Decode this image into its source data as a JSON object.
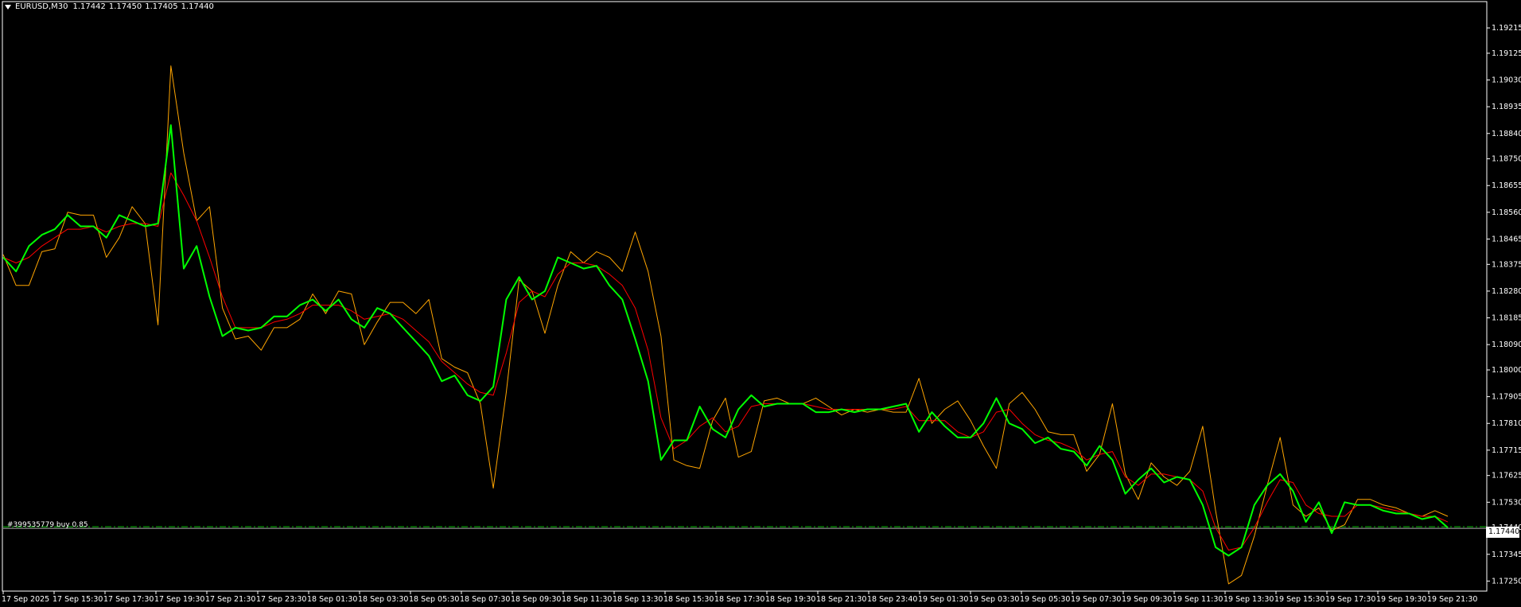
{
  "header": {
    "symbol": "EURUSD,M30",
    "open": "1.17442",
    "high": "1.17450",
    "low": "1.17405",
    "close": "1.17440"
  },
  "price_axis": {
    "labels": [
      "1.19215",
      "1.19125",
      "1.19030",
      "1.18935",
      "1.18840",
      "1.18750",
      "1.18655",
      "1.18560",
      "1.18465",
      "1.18375",
      "1.18280",
      "1.18185",
      "1.18090",
      "1.18000",
      "1.17905",
      "1.17810",
      "1.17715",
      "1.17625",
      "1.17530",
      "1.17440",
      "1.17345",
      "1.17250"
    ],
    "current_price": "1.17440"
  },
  "time_axis": {
    "labels": [
      "17 Sep 2025",
      "17 Sep 15:30",
      "17 Sep 17:30",
      "17 Sep 19:30",
      "17 Sep 21:30",
      "17 Sep 23:30",
      "18 Sep 01:30",
      "18 Sep 03:30",
      "18 Sep 05:30",
      "18 Sep 07:30",
      "18 Sep 09:30",
      "18 Sep 11:30",
      "18 Sep 13:30",
      "18 Sep 15:30",
      "18 Sep 17:30",
      "18 Sep 19:30",
      "18 Sep 21:30",
      "18 Sep 23:40",
      "19 Sep 01:30",
      "19 Sep 03:30",
      "19 Sep 05:30",
      "19 Sep 07:30",
      "19 Sep 09:30",
      "19 Sep 11:30",
      "19 Sep 13:30",
      "19 Sep 15:30",
      "19 Sep 17:30",
      "19 Sep 19:30",
      "19 Sep 21:30"
    ]
  },
  "order": {
    "label": "#399535779 buy 0.85",
    "price": 1.1744
  },
  "colors": {
    "background": "#000000",
    "price_line": "#00ff00",
    "fast_ma": "#ff0000",
    "envelope_line": "#ffa500",
    "order_line": "#00c000",
    "text": "#ffffff"
  },
  "chart_data": {
    "type": "line",
    "title": "EURUSD,M30",
    "xlabel": "",
    "ylabel": "",
    "ylim": [
      1.1722,
      1.193
    ],
    "grid": false,
    "series": [
      {
        "name": "",
        "color": "#00ff00",
        "values": [
          1.184,
          1.1835,
          1.1844,
          1.1848,
          1.185,
          1.1855,
          1.1851,
          1.1851,
          1.1847,
          1.1855,
          1.1853,
          1.1851,
          1.1852,
          1.1887,
          1.1836,
          1.1844,
          1.1826,
          1.1812,
          1.1815,
          1.1814,
          1.1815,
          1.1819,
          1.1819,
          1.1823,
          1.1825,
          1.1821,
          1.1825,
          1.1818,
          1.1815,
          1.1822,
          1.182,
          1.1815,
          1.181,
          1.1805,
          1.1796,
          1.1798,
          1.1791,
          1.1789,
          1.1794,
          1.1825,
          1.1833,
          1.1825,
          1.1828,
          1.184,
          1.1838,
          1.1836,
          1.1837,
          1.183,
          1.1825,
          1.1811,
          1.1796,
          1.1768,
          1.1775,
          1.1775,
          1.1787,
          1.1779,
          1.1776,
          1.1786,
          1.1791,
          1.1787,
          1.1788,
          1.1788,
          1.1788,
          1.1785,
          1.1785,
          1.1786,
          1.1785,
          1.1786,
          1.1786,
          1.1787,
          1.1788,
          1.1778,
          1.1785,
          1.178,
          1.1776,
          1.1776,
          1.1781,
          1.179,
          1.1781,
          1.1779,
          1.1774,
          1.1776,
          1.1772,
          1.1771,
          1.1766,
          1.1773,
          1.1768,
          1.1756,
          1.1761,
          1.1765,
          1.176,
          1.1762,
          1.1761,
          1.1752,
          1.1737,
          1.1734,
          1.1737,
          1.1752,
          1.1759,
          1.1763,
          1.1757,
          1.1746,
          1.1753,
          1.1742,
          1.1753,
          1.1752,
          1.1752,
          1.175,
          1.1749,
          1.1749,
          1.1747,
          1.1748,
          1.1744
        ]
      },
      {
        "name": "",
        "color": "#ff0000",
        "values": [
          1.184,
          1.1838,
          1.184,
          1.1844,
          1.1847,
          1.185,
          1.185,
          1.1851,
          1.1849,
          1.1851,
          1.1852,
          1.1852,
          1.1851,
          1.187,
          1.1862,
          1.1853,
          1.184,
          1.1826,
          1.1815,
          1.1815,
          1.1815,
          1.1817,
          1.1818,
          1.182,
          1.1823,
          1.1823,
          1.1823,
          1.1821,
          1.1818,
          1.1819,
          1.182,
          1.1818,
          1.1814,
          1.181,
          1.1803,
          1.1799,
          1.1795,
          1.1792,
          1.1791,
          1.1806,
          1.1824,
          1.1828,
          1.1826,
          1.1834,
          1.1838,
          1.1838,
          1.1837,
          1.1834,
          1.183,
          1.1822,
          1.1807,
          1.1783,
          1.1772,
          1.1775,
          1.178,
          1.1783,
          1.1778,
          1.178,
          1.1787,
          1.1788,
          1.1788,
          1.1788,
          1.1788,
          1.1787,
          1.1786,
          1.1786,
          1.1786,
          1.1786,
          1.1786,
          1.1786,
          1.1787,
          1.1782,
          1.1782,
          1.1782,
          1.1778,
          1.1776,
          1.1778,
          1.1785,
          1.1786,
          1.1781,
          1.1777,
          1.1775,
          1.1774,
          1.1772,
          1.1768,
          1.177,
          1.1771,
          1.1762,
          1.1759,
          1.1763,
          1.1763,
          1.1762,
          1.1761,
          1.1757,
          1.1744,
          1.1736,
          1.1737,
          1.1744,
          1.1753,
          1.1761,
          1.176,
          1.1752,
          1.1749,
          1.1748,
          1.1748,
          1.1752,
          1.1752,
          1.1751,
          1.175,
          1.1749,
          1.1748,
          1.1748,
          1.1746
        ]
      },
      {
        "name": "",
        "color": "#ffa500",
        "values": [
          1.1841,
          1.183,
          1.183,
          1.1842,
          1.1843,
          1.1856,
          1.1855,
          1.1855,
          1.184,
          1.1847,
          1.1858,
          1.1852,
          1.1816,
          1.1908,
          1.1877,
          1.1853,
          1.1858,
          1.1822,
          1.1811,
          1.1812,
          1.1807,
          1.1815,
          1.1815,
          1.1818,
          1.1827,
          1.182,
          1.1828,
          1.1827,
          1.1809,
          1.1817,
          1.1824,
          1.1824,
          1.182,
          1.1825,
          1.1804,
          1.1801,
          1.1799,
          1.1788,
          1.1758,
          1.1792,
          1.1832,
          1.1828,
          1.1813,
          1.183,
          1.1842,
          1.1838,
          1.1842,
          1.184,
          1.1835,
          1.1849,
          1.1835,
          1.1812,
          1.1768,
          1.1766,
          1.1765,
          1.1782,
          1.179,
          1.1769,
          1.1771,
          1.1789,
          1.179,
          1.1788,
          1.1788,
          1.179,
          1.1787,
          1.1784,
          1.1786,
          1.1785,
          1.1786,
          1.1785,
          1.1785,
          1.1797,
          1.1781,
          1.1786,
          1.1789,
          1.1782,
          1.1773,
          1.1765,
          1.1788,
          1.1792,
          1.1786,
          1.1778,
          1.1777,
          1.1777,
          1.1764,
          1.177,
          1.1788,
          1.1763,
          1.1754,
          1.1767,
          1.1762,
          1.1759,
          1.1764,
          1.178,
          1.175,
          1.1724,
          1.1727,
          1.1741,
          1.1759,
          1.1776,
          1.1752,
          1.1748,
          1.1751,
          1.1743,
          1.1745,
          1.1754,
          1.1754,
          1.1752,
          1.1751,
          1.1749,
          1.1748,
          1.175,
          1.1748
        ]
      }
    ]
  }
}
